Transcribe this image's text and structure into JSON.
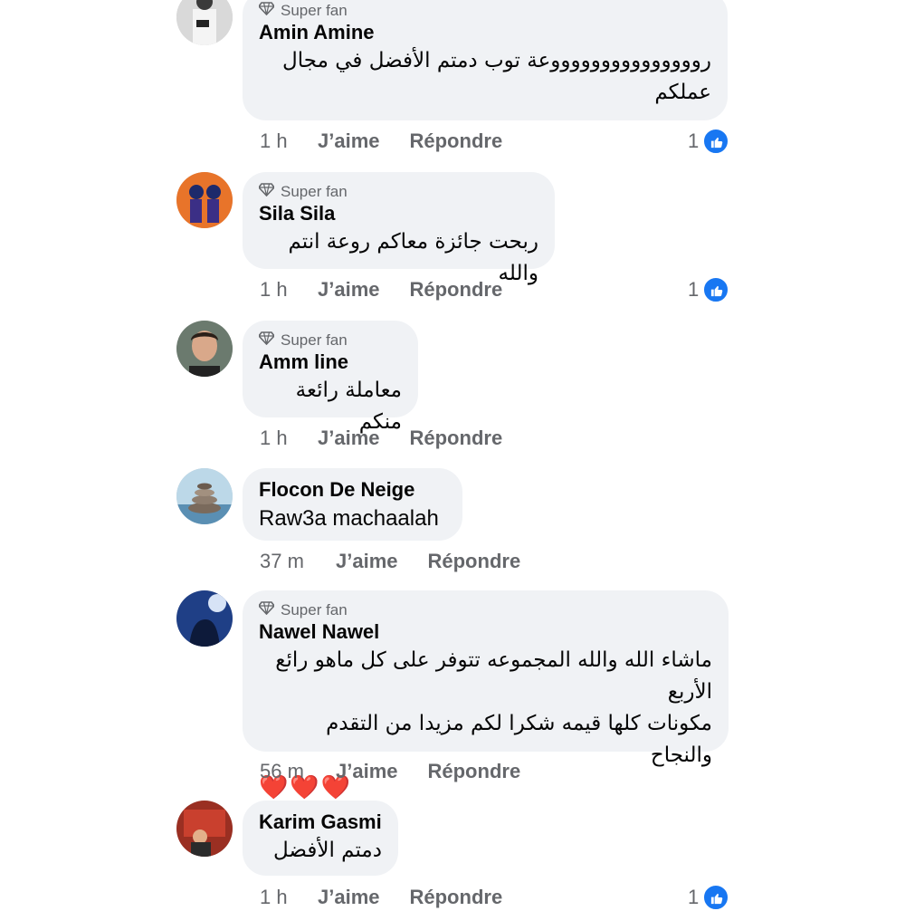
{
  "badge_label": "Super fan",
  "action_like": "J’aime",
  "action_reply": "Répondre",
  "accent_color": "#1877f2",
  "comments": [
    {
      "author": "Amin Amine",
      "super_fan": true,
      "text_line1": "روووووووووووووووعة توب دمتم الأفضل في مجال",
      "text_line2": "عملكم",
      "time": "1 h",
      "reactions": "1"
    },
    {
      "author": "Sila Sila",
      "super_fan": true,
      "text_line1": "ربحت جائزة معاكم روعة انتم والله",
      "time": "1 h",
      "reactions": "1"
    },
    {
      "author": "Amm line",
      "super_fan": true,
      "text_line1": "معاملة رائعة منكم",
      "time": "1 h"
    },
    {
      "author": "Flocon De Neige",
      "super_fan": false,
      "text_line1": "Raw3a machaalah",
      "time": "37 m"
    },
    {
      "author": "Nawel Nawel",
      "super_fan": true,
      "text_line1": "ماشاء الله والله المجموعه تتوفر على كل ماهو رائع الأربع",
      "text_line2": "مكونات كلها قيمه شكرا لكم مزيدا من التقدم والنجاح",
      "text_line3": "❤️❤️❤️",
      "time": "56 m"
    },
    {
      "author": "Karim Gasmi",
      "super_fan": false,
      "text_line1": "دمتم الأفضل",
      "time": "1 h",
      "reactions": "1"
    }
  ]
}
